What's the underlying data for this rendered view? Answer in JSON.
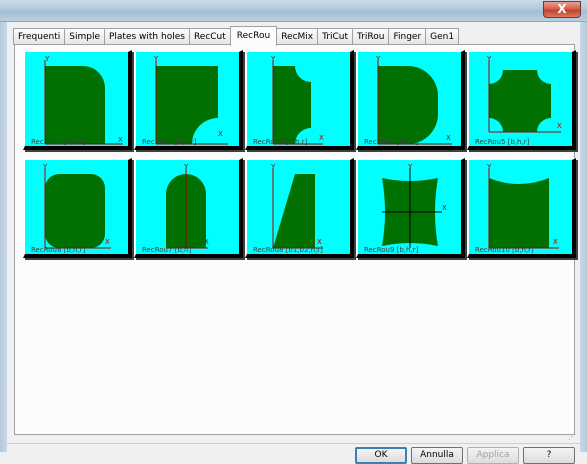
{
  "window": {
    "close_glyph": "X"
  },
  "tabs": [
    {
      "label": "Frequenti"
    },
    {
      "label": "Simple"
    },
    {
      "label": "Plates with holes"
    },
    {
      "label": "RecCut"
    },
    {
      "label": "RecRou",
      "active": true
    },
    {
      "label": "RecMix"
    },
    {
      "label": "TriCut"
    },
    {
      "label": "TriRou"
    },
    {
      "label": "Finger"
    },
    {
      "label": "Gen1"
    }
  ],
  "shapes": [
    {
      "label": "RecRou1 [b,h,r]",
      "icon": "recrou1-shape-icon"
    },
    {
      "label": "RecRou2 [b,h,r]",
      "icon": "recrou2-shape-icon"
    },
    {
      "label": "RecRou3 [b,h,r]",
      "icon": "recrou3-shape-icon"
    },
    {
      "label": "RecRou4 [b,h,r]",
      "icon": "recrou4-shape-icon"
    },
    {
      "label": "RecRou5 [b,h,r]",
      "icon": "recrou5-shape-icon"
    },
    {
      "label": "RecRou6 [b,h,r]",
      "icon": "recrou6-shape-icon"
    },
    {
      "label": "RecRou7 [b,h]",
      "icon": "recrou7-shape-icon"
    },
    {
      "label": "RecRou8 [b1,b2,h,r]",
      "icon": "recrou8-shape-icon"
    },
    {
      "label": "RecRou9 [b,h,r]",
      "icon": "recrou9-shape-icon"
    },
    {
      "label": "RecRou10 [b,h,r]",
      "icon": "recrou10-shape-icon"
    }
  ],
  "axes": {
    "x": "X",
    "y": "Y"
  },
  "colors": {
    "shape_fill": "#007000",
    "cell_bg": "#00ffff",
    "axis": "#a00000"
  },
  "buttons": {
    "ok": "OK",
    "cancel": "Annulla",
    "apply": "Applica",
    "help": "?"
  }
}
